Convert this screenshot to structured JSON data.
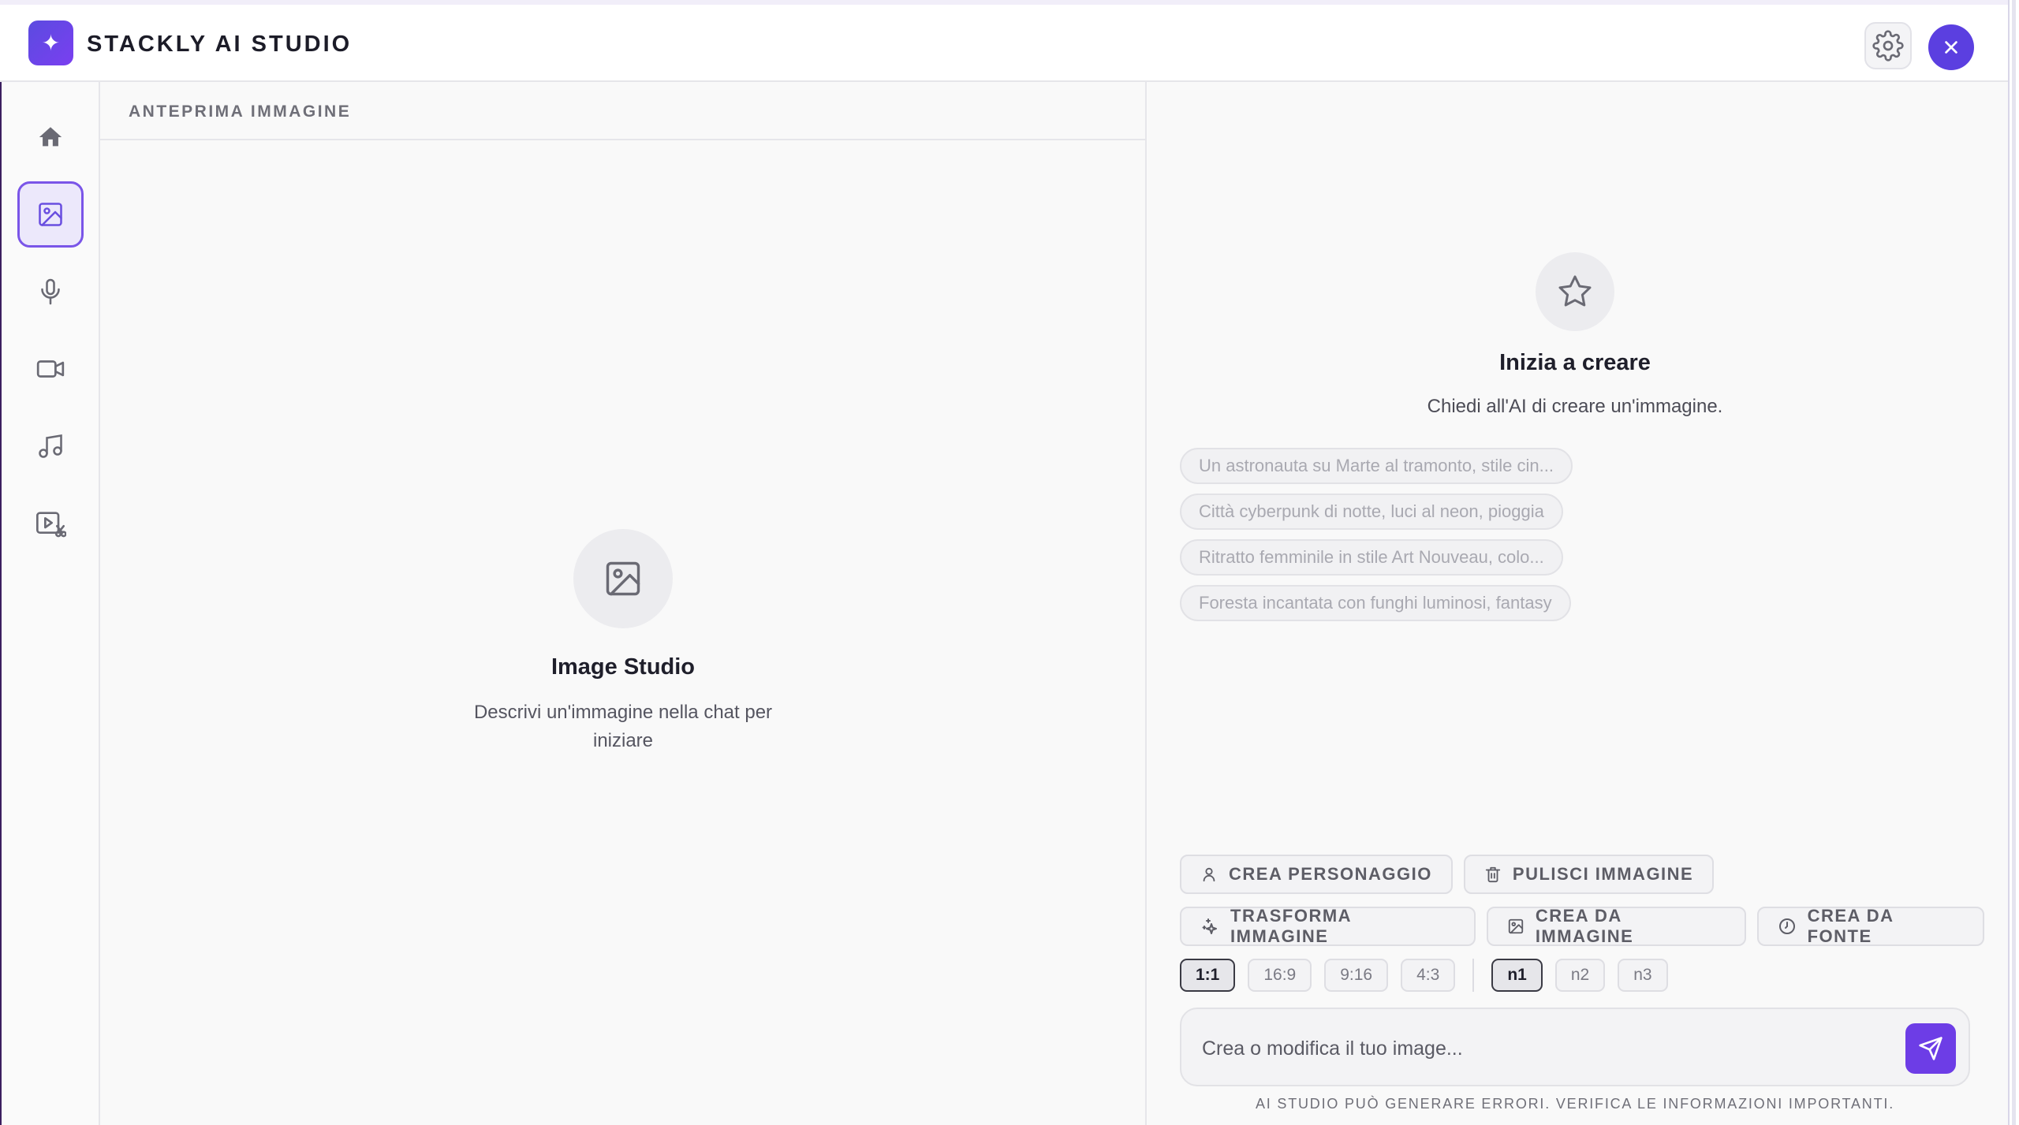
{
  "header": {
    "logo_glyph": "✦",
    "app_title": "STACKLY AI STUDIO",
    "settings_icon": "gear-icon",
    "close_icon": "close-icon"
  },
  "sidebar": {
    "items": [
      {
        "name": "home",
        "icon": "home-icon",
        "active": false
      },
      {
        "name": "image",
        "icon": "image-icon",
        "active": true
      },
      {
        "name": "voice",
        "icon": "microphone-icon",
        "active": false
      },
      {
        "name": "video",
        "icon": "video-camera-icon",
        "active": false
      },
      {
        "name": "music",
        "icon": "music-note-icon",
        "active": false
      },
      {
        "name": "video-edit",
        "icon": "video-edit-icon",
        "active": false
      }
    ]
  },
  "preview": {
    "label": "ANTEPRIMA IMMAGINE",
    "placeholder_title": "Image Studio",
    "placeholder_sub_line1": "Descrivi un'immagine nella chat per",
    "placeholder_sub_line2": "iniziare"
  },
  "chat": {
    "start_title": "Inizia a creare",
    "start_sub": "Chiedi all'AI di creare un'immagine.",
    "suggestions": [
      "Un astronauta su Marte al tramonto, stile cin...",
      "Città cyberpunk di notte, luci al neon, pioggia",
      "Ritratto femminile in stile Art Nouveau, colo...",
      "Foresta incantata con funghi luminosi, fantasy"
    ],
    "actions": [
      {
        "label": "CREA PERSONAGGIO",
        "icon": "person-icon"
      },
      {
        "label": "PULISCI IMMAGINE",
        "icon": "trash-icon"
      },
      {
        "label": "TRASFORMA IMMAGINE",
        "icon": "sparkle-icon"
      },
      {
        "label": "CREA DA IMMAGINE",
        "icon": "image-icon"
      },
      {
        "label": "CREA DA FONTE",
        "icon": "clock-icon"
      }
    ],
    "aspect_ratios": [
      "1:1",
      "16:9",
      "9:16",
      "4:3"
    ],
    "aspect_selected": "1:1",
    "counts": [
      "n1",
      "n2",
      "n3"
    ],
    "count_selected": "n1",
    "input_placeholder": "Crea o modifica il tuo image...",
    "disclaimer": "AI STUDIO PUÒ GENERARE ERRORI. VERIFICA LE INFORMAZIONI IMPORTANTI.",
    "accent_color": "#6d3de6"
  }
}
